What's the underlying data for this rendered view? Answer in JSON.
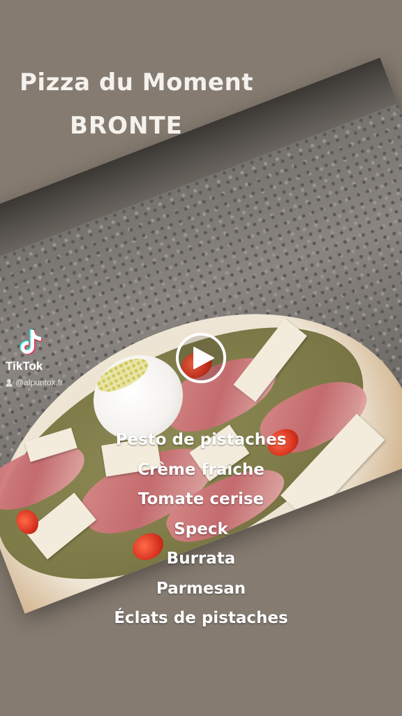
{
  "header": {
    "title": "Pizza du Moment",
    "subtitle": "BRONTE"
  },
  "watermark": {
    "brand": "TikTok",
    "username": "@alpuntox.fr",
    "logo_icon": "tiktok-logo-icon",
    "user_icon": "user-icon"
  },
  "player": {
    "play_icon": "play-icon"
  },
  "ingredients": [
    "Pesto de pistaches",
    "Crème fraîche",
    "Tomate cerise",
    "Speck",
    "Burrata",
    "Parmesan",
    "Éclats de pistaches"
  ],
  "colors": {
    "background": "#857b70",
    "text": "#ffffff"
  }
}
